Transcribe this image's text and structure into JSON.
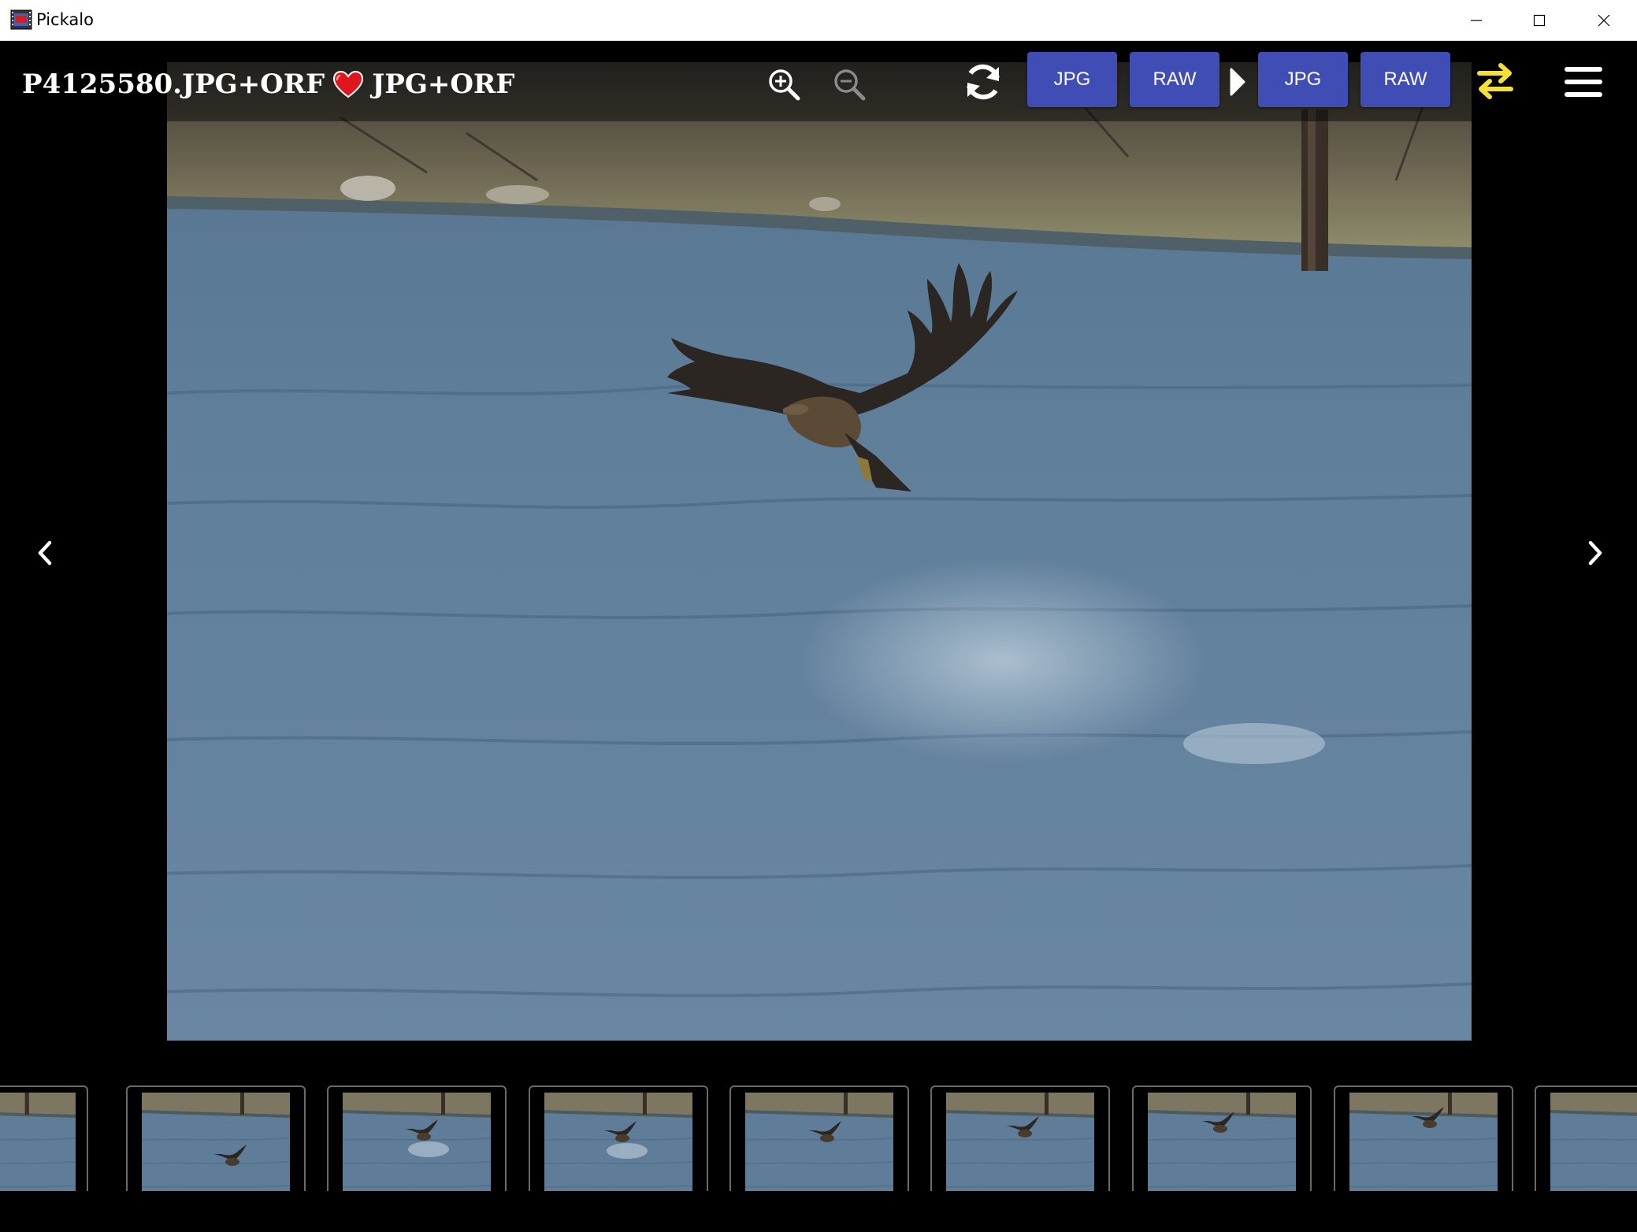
{
  "window": {
    "title": "Pickalo"
  },
  "viewer": {
    "file_name": "P4125580.JPG+ORF",
    "file_format": "JPG+ORF",
    "source_formats": [
      "JPG",
      "RAW"
    ],
    "target_formats": [
      "JPG",
      "RAW"
    ],
    "icons": {
      "zoom_in": "zoom-in-icon",
      "zoom_out": "zoom-out-icon",
      "refresh": "refresh-icon",
      "arrow": "play-arrow-icon",
      "swap": "swap-icon",
      "menu": "hamburger-menu-icon",
      "favorite": "heart-icon"
    },
    "colors": {
      "button_bg": "#3f4db4",
      "swap_icon": "#f5e03a",
      "heart": "#e0161e"
    }
  },
  "filmstrip": {
    "thumbnails": [
      {
        "subject": "eagle-partial"
      },
      {
        "subject": "eagle-diving"
      },
      {
        "subject": "eagle-splash"
      },
      {
        "subject": "eagle-splash-low"
      },
      {
        "subject": "eagle-flying"
      },
      {
        "subject": "eagle-wings-up"
      },
      {
        "subject": "eagle-wings-spread"
      },
      {
        "subject": "eagle-landing"
      },
      {
        "subject": "partial"
      }
    ]
  }
}
